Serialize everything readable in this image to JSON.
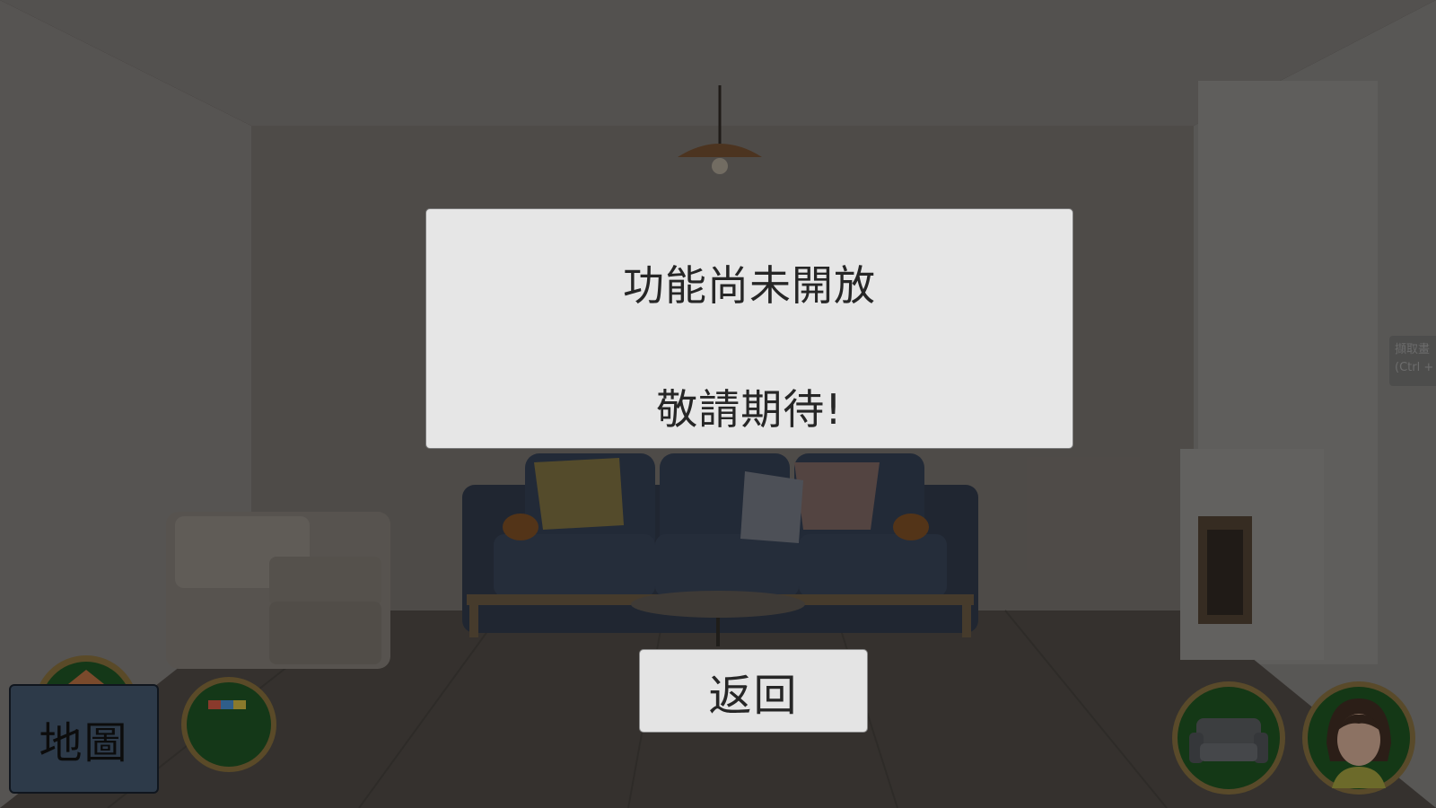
{
  "dialog": {
    "title": "功能尚未開放",
    "message": "敬請期待!"
  },
  "buttons": {
    "back_label": "返回",
    "map_label": "地圖"
  },
  "side_hint": {
    "line1": "擷取畫",
    "line2": "(Ctrl +"
  },
  "colors": {
    "dialog_bg": "#e6e6e6",
    "map_button_bg": "#2d3a49",
    "badge_gold": "#b89a55",
    "badge_green": "#1f6a2a"
  },
  "icons": {
    "furniture_badge": "sofa-icon",
    "character_badge": "avatar-icon",
    "home_badge": "house-icon",
    "shop_badge": "shop-icon"
  }
}
